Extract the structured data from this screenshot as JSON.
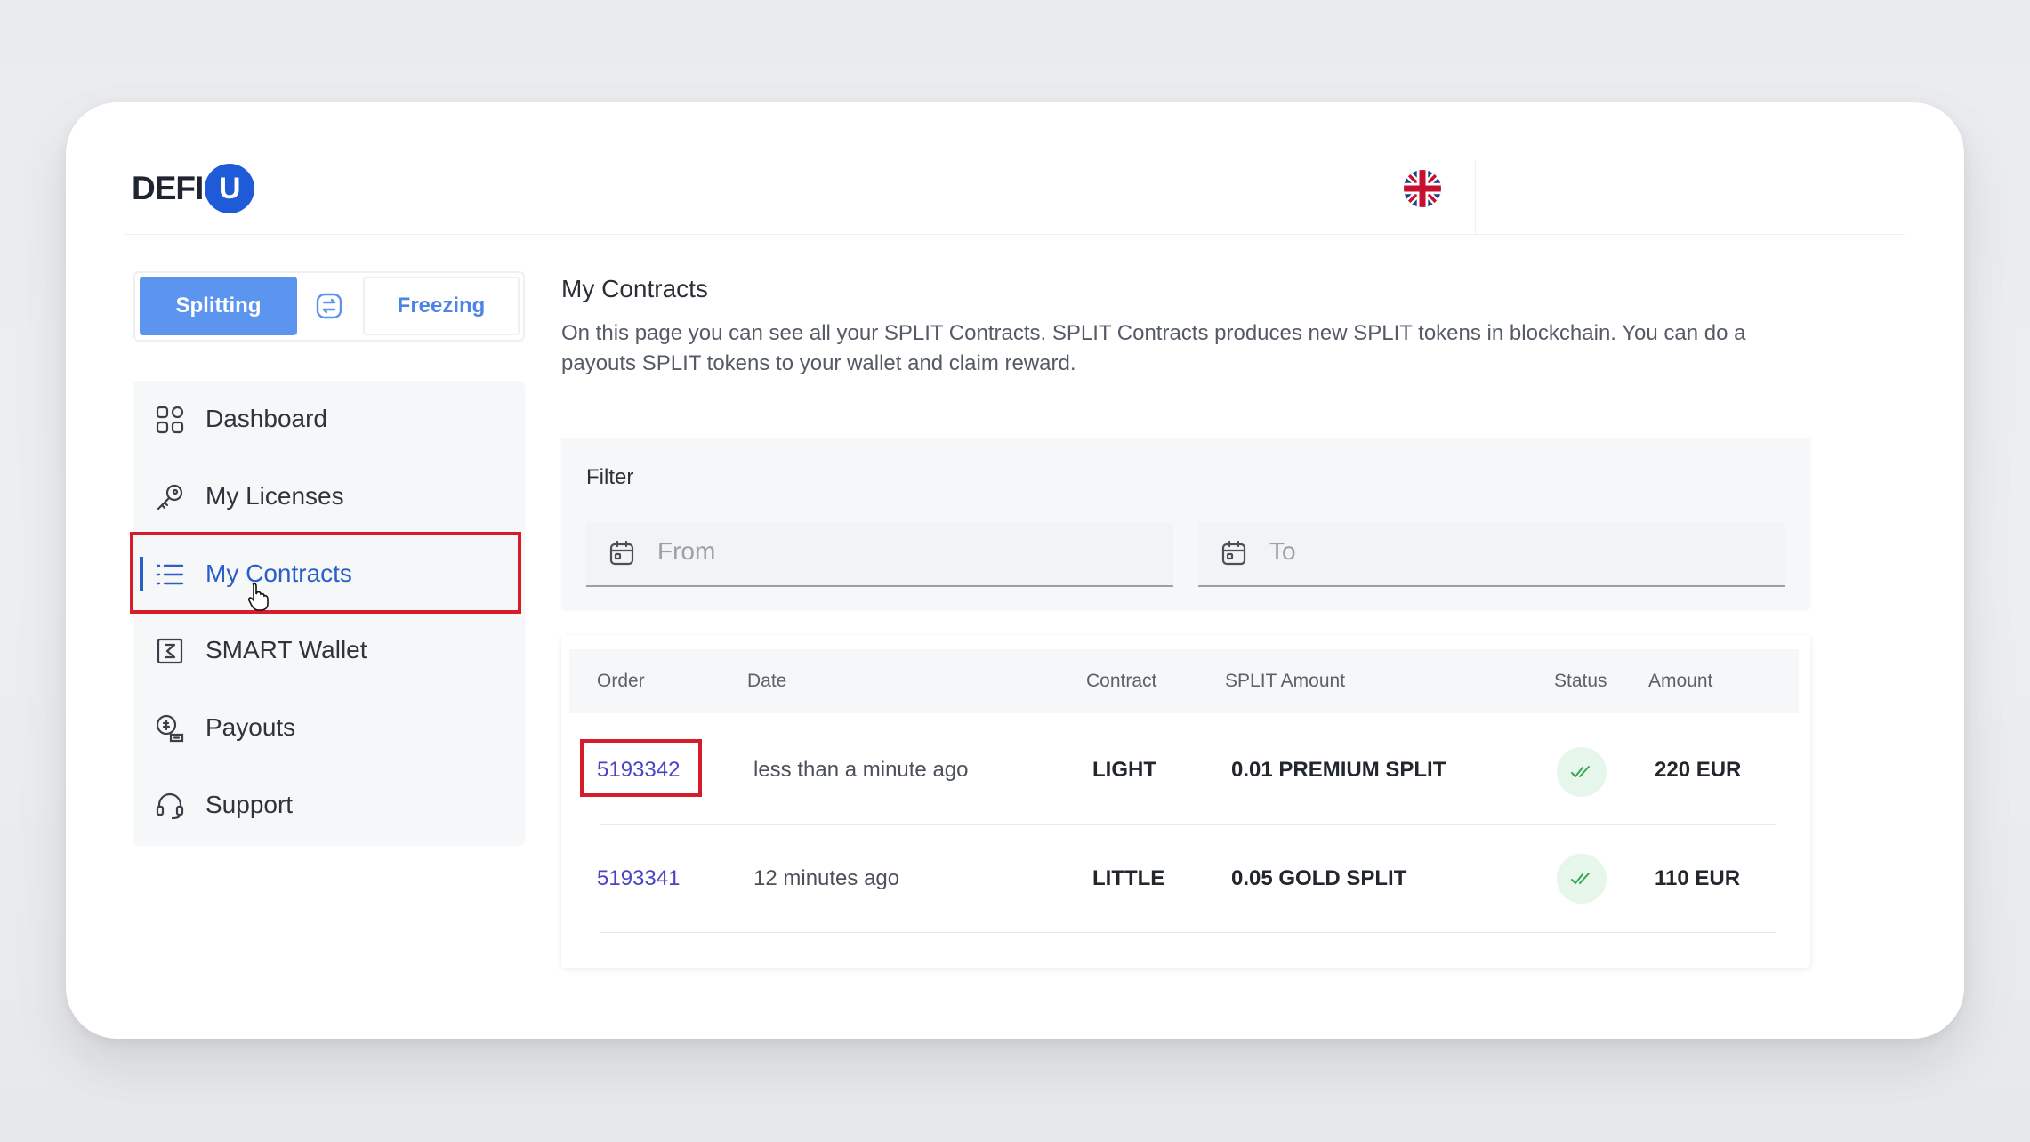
{
  "header": {
    "logo_text": "DEFI",
    "logo_mark": "U",
    "language_icon": "uk-flag-icon"
  },
  "mode_switch": {
    "splitting_label": "Splitting",
    "swap_icon": "swap-icon",
    "freezing_label": "Freezing",
    "accent_color": "#5b95f0"
  },
  "sidebar": {
    "items": [
      {
        "label": "Dashboard",
        "icon": "grid-icon"
      },
      {
        "label": "My Licenses",
        "icon": "key-icon"
      },
      {
        "label": "My Contracts",
        "icon": "list-icon",
        "active": true
      },
      {
        "label": "SMART Wallet",
        "icon": "wallet-icon"
      },
      {
        "label": "Payouts",
        "icon": "payouts-icon"
      },
      {
        "label": "Support",
        "icon": "headset-icon"
      }
    ]
  },
  "main": {
    "title": "My Contracts",
    "description": "On this page you can see all your SPLIT Contracts. SPLIT Contracts produces new SPLIT tokens in blockchain. You can do a payouts SPLIT tokens to your wallet and claim reward.",
    "filter": {
      "label": "Filter",
      "from_placeholder": "From",
      "to_placeholder": "To"
    },
    "table": {
      "columns": [
        "Order",
        "Date",
        "Contract",
        "SPLIT Amount",
        "Status",
        "Amount"
      ],
      "rows": [
        {
          "order": "5193342",
          "date": "less than a minute ago",
          "contract": "LIGHT",
          "split_amount": "0.01 PREMIUM SPLIT",
          "status": "confirmed",
          "amount": "220 EUR"
        },
        {
          "order": "5193341",
          "date": "12 minutes ago",
          "contract": "LITTLE",
          "split_amount": "0.05 GOLD SPLIT",
          "status": "confirmed",
          "amount": "110 EUR"
        }
      ]
    }
  },
  "colors": {
    "link": "#4a43c6",
    "active_nav": "#2b5fc7",
    "highlight": "#d81b2b",
    "status_ok_bg": "#e6f6ea",
    "status_ok_check": "#3aa656"
  }
}
